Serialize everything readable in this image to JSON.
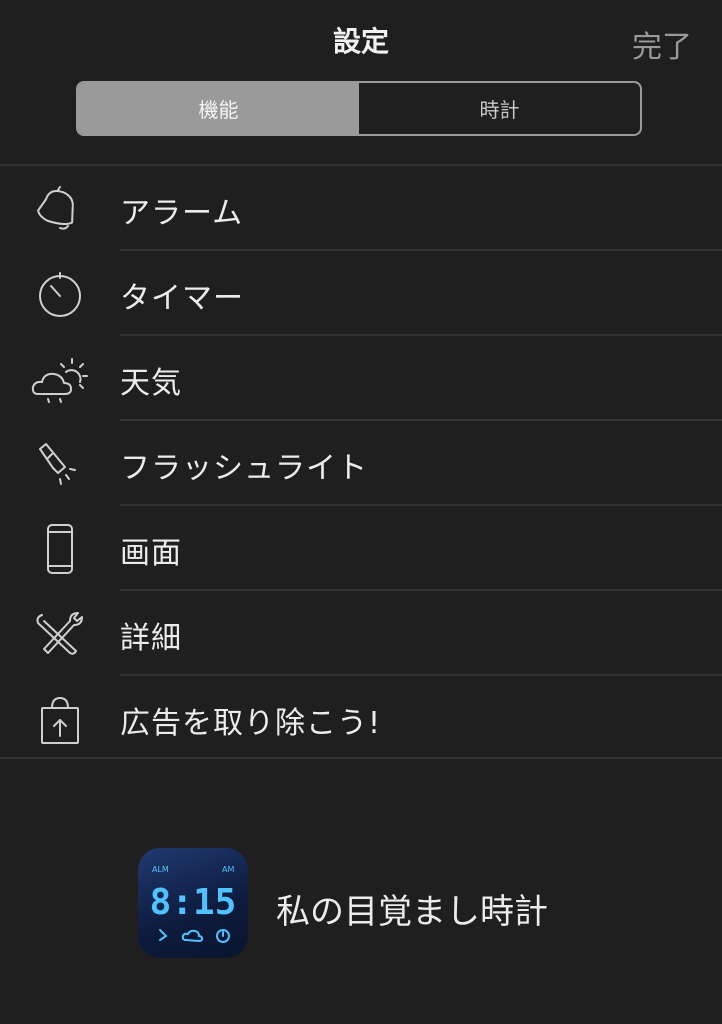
{
  "header": {
    "title": "設定",
    "done_label": "完了"
  },
  "segments": [
    {
      "label": "機能",
      "active": true
    },
    {
      "label": "時計",
      "active": false
    }
  ],
  "menu": [
    {
      "label": "アラーム",
      "icon": "bell-icon"
    },
    {
      "label": "タイマー",
      "icon": "timer-icon"
    },
    {
      "label": "天気",
      "icon": "weather-icon"
    },
    {
      "label": "フラッシュライト",
      "icon": "flashlight-icon"
    },
    {
      "label": "画面",
      "icon": "phone-screen-icon"
    },
    {
      "label": "詳細",
      "icon": "tools-icon"
    },
    {
      "label": "広告を取り除こう!",
      "icon": "purchase-bag-icon"
    }
  ],
  "promo": {
    "app_name": "私の目覚まし時計",
    "icon_time": "8:15",
    "icon_left_tag": "ALM",
    "icon_right_tag": "AM"
  },
  "colors": {
    "background": "#1f1f1f",
    "segment_active": "#9a9a9a",
    "divider": "#333333",
    "icon_digits": "#4fc3ff"
  }
}
